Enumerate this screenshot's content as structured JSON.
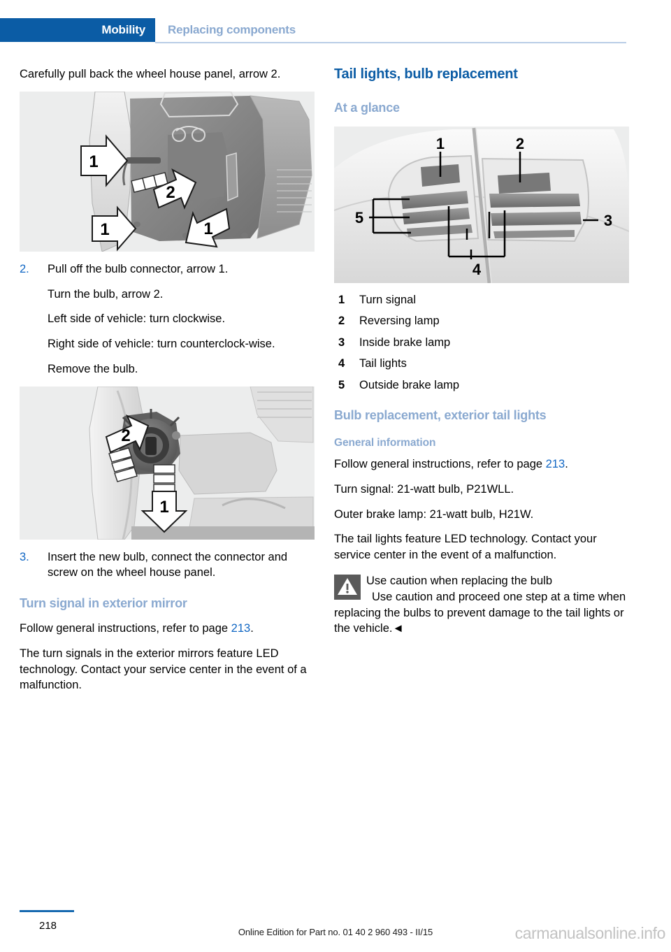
{
  "header": {
    "tab_label": "Mobility",
    "section_label": "Replacing components"
  },
  "left_column": {
    "intro_text": "Carefully pull back the wheel house panel, arrow 2.",
    "figure_1": {
      "name": "wheel-house-panel-illustration",
      "callouts": [
        "1",
        "2",
        "1",
        "1"
      ]
    },
    "step_2": {
      "number": "2.",
      "lines": [
        "Pull off the bulb connector, arrow 1.",
        "Turn the bulb, arrow 2.",
        "Left side of vehicle: turn clockwise.",
        "Right side of vehicle: turn counterclock-wise.",
        "Remove the bulb."
      ]
    },
    "figure_2": {
      "name": "bulb-connector-illustration",
      "callouts": [
        "2",
        "1"
      ]
    },
    "step_3": {
      "number": "3.",
      "text": "Insert the new bulb, connect the connector and screw on the wheel house panel."
    },
    "mirror_heading": "Turn signal in exterior mirror",
    "mirror_para_1_before": "Follow general instructions, refer to page ",
    "mirror_para_1_ref": "213",
    "mirror_para_1_after": ".",
    "mirror_para_2": "The turn signals in the exterior mirrors feature LED technology. Contact your service center in the event of a malfunction."
  },
  "right_column": {
    "main_heading": "Tail lights, bulb replacement",
    "at_a_glance_heading": "At a glance",
    "figure_3": {
      "name": "tail-light-assembly-illustration",
      "callouts": [
        "1",
        "2",
        "3",
        "4",
        "5"
      ]
    },
    "legend": [
      {
        "num": "1",
        "label": "Turn signal"
      },
      {
        "num": "2",
        "label": "Reversing lamp"
      },
      {
        "num": "3",
        "label": "Inside brake lamp"
      },
      {
        "num": "4",
        "label": "Tail lights"
      },
      {
        "num": "5",
        "label": "Outside brake lamp"
      }
    ],
    "bulb_replacement_heading": "Bulb replacement, exterior tail lights",
    "general_information_heading": "General information",
    "gen_para_1_before": "Follow general instructions, refer to page ",
    "gen_para_1_ref": "213",
    "gen_para_1_after": ".",
    "gen_para_2": "Turn signal: 21-watt bulb, P21WLL.",
    "gen_para_3": "Outer brake lamp: 21-watt bulb, H21W.",
    "gen_para_4": "The tail lights feature LED technology. Contact your service center in the event of a malfunction.",
    "warning": {
      "title": "Use caution when replacing the bulb",
      "body": "Use caution and proceed one step at a time when replacing the bulbs to prevent damage to the tail lights or the vehicle.",
      "end_marker": "◄"
    }
  },
  "footer": {
    "page_number": "218",
    "note": "Online Edition for Part no. 01 40 2 960 493 - II/15",
    "watermark": "carmanualsonline.info"
  },
  "colors": {
    "brand_blue": "#0b5ca5",
    "light_blue": "#8aa9d0",
    "link_blue": "#1167c4",
    "rule_blue": "#b9cde6",
    "figure_bg": "#eceded",
    "warning_gray": "#5a5a5a"
  }
}
